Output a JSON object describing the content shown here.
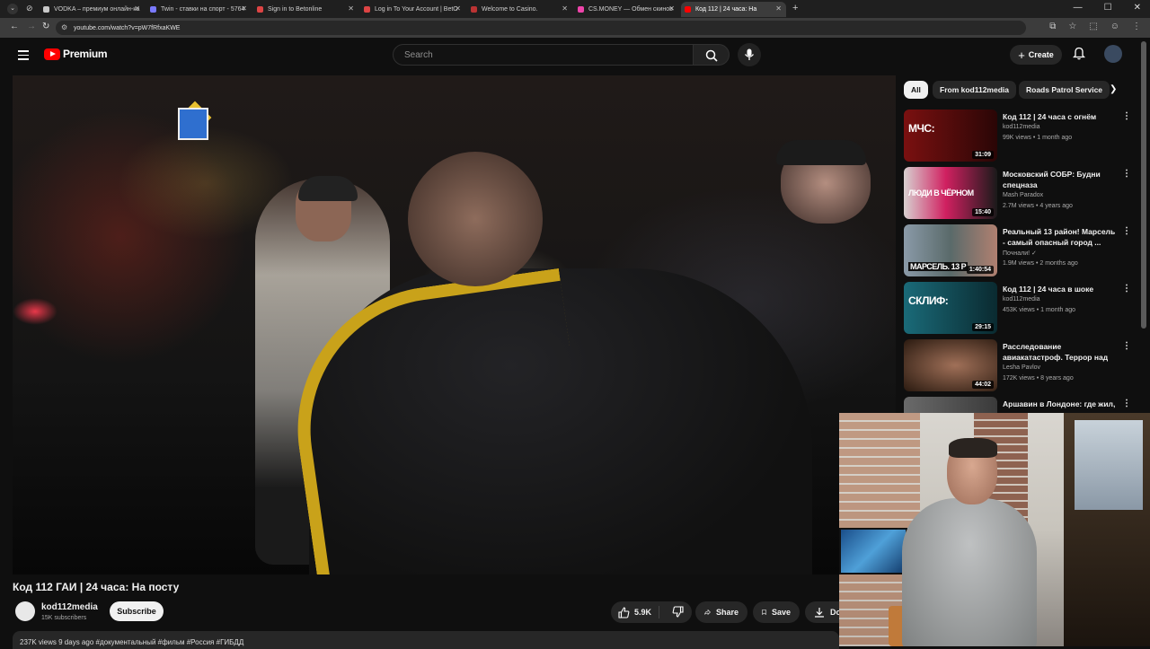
{
  "browser": {
    "tabs": [
      {
        "title": "VODKA – премиум онлайн-ка",
        "color": "#c9c9c9"
      },
      {
        "title": "Twin - ставки на спорт - 5764",
        "color": "#7a7aff"
      },
      {
        "title": "Sign in to Betonline",
        "color": "#d44"
      },
      {
        "title": "Log in To Your Account | BetO",
        "color": "#d44"
      },
      {
        "title": "Welcome to Casino.",
        "color": "#b33"
      },
      {
        "title": "CS.MONEY — Обмен скинов",
        "color": "#e4a"
      },
      {
        "title": "Код 112 | 24 часа: На",
        "color": "#ff0000"
      }
    ],
    "url": "youtube.com/watch?v=pW7fRfxaKWE"
  },
  "youtube": {
    "logo_text": "Premium",
    "search_placeholder": "Search",
    "create_label": "Create"
  },
  "video": {
    "title": "Код 112 ГАИ | 24 часа: На посту",
    "channel": "kod112media",
    "subscribers": "15K subscribers",
    "subscribe_label": "Subscribe",
    "likes": "5.9K",
    "share_label": "Share",
    "save_label": "Save",
    "download_label": "Dov",
    "description_preview": "237K views  9 days ago  #документальный #фильм #Россия #ГИБДД"
  },
  "chips": [
    {
      "label": "All",
      "active": true
    },
    {
      "label": "From kod112media",
      "active": false
    },
    {
      "label": "Roads Patrol Service",
      "active": false
    }
  ],
  "recommendations": [
    {
      "title": "Код 112 | 24 часа с огнём",
      "channel": "kod112media",
      "meta": "99K views • 1 month ago",
      "duration": "31:09",
      "thumb_text": "МЧС:",
      "thumb_color": "#6a1010"
    },
    {
      "title": "Московский СОБР: Будни спецназа",
      "channel": "Mash Paradox",
      "meta": "2.7M views • 4 years ago",
      "duration": "15:40",
      "thumb_text": "ЛЮДИ В ЧЁРНОМ",
      "thumb_color": "#c8205a"
    },
    {
      "title": "Реальный 13 район! Марсель - самый опасный город ...",
      "channel": "Почнали! ✓",
      "meta": "1.9M views • 2 months ago",
      "duration": "1:40:54",
      "thumb_text": "МАРСЕЛЬ. 13 Р",
      "thumb_color": "#5a6a7a"
    },
    {
      "title": "Код 112 | 24 часа в шоке",
      "channel": "kod112media",
      "meta": "453K views • 1 month ago",
      "duration": "29:15",
      "thumb_text": "СКЛИФ:",
      "thumb_color": "#0f5f6a"
    },
    {
      "title": "Расследование авиакатастроф. Террор над ...",
      "channel": "Lesha Pavlov",
      "meta": "172K views • 8 years ago",
      "duration": "44:02",
      "thumb_text": "",
      "thumb_color": "#3a2a1e"
    },
    {
      "title": "Аршавин в Лондоне: где жил,",
      "channel": "",
      "meta": "",
      "duration": "",
      "thumb_text": "",
      "thumb_color": "#4a4a4a"
    }
  ]
}
